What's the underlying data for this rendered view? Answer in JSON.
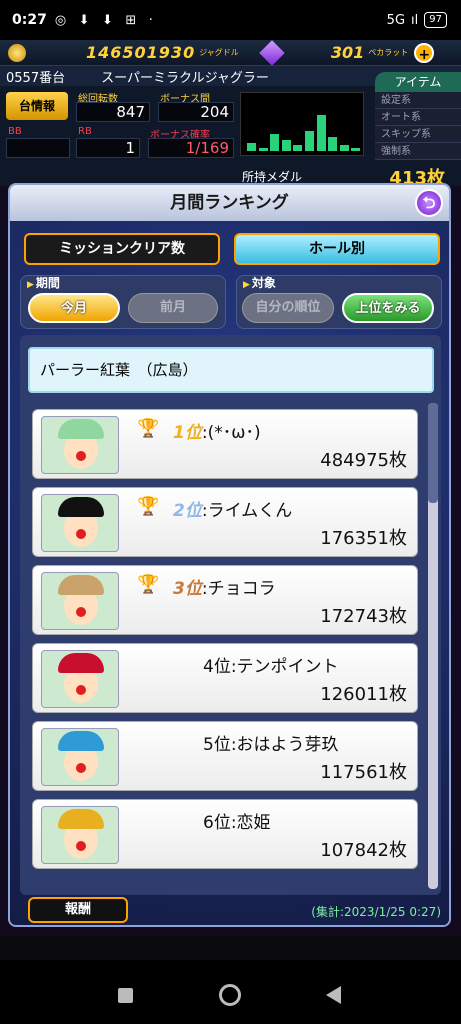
{
  "status_bar": {
    "time": "0:27",
    "icons": [
      "◎",
      "⬇",
      "⬇",
      "⊞",
      "·"
    ],
    "network": "5G",
    "signal": "ıl",
    "battery": "97"
  },
  "top_bar": {
    "coins": "146501930",
    "coin_unit": "ジャグドル",
    "gems": "301",
    "gem_unit": "ぺカラット",
    "plus": "+"
  },
  "machine": {
    "number": "0557番台",
    "name": "スーパーミラクルジャグラー",
    "item_tab": "アイテム"
  },
  "info": {
    "info_button": "台情報",
    "total_spins_label": "総回転数",
    "total_spins": "847",
    "bonus_interval_label": "ボーナス間",
    "bonus_interval": "204",
    "bb_label": "BB",
    "bb": "",
    "rb_label": "RB",
    "rb": "1",
    "bonus_prob_label": "ボーナス確率",
    "bonus_prob": "1/169",
    "medal_label": "所持メダル",
    "medal_value": "413枚"
  },
  "side_menu": [
    "設定系",
    "オート系",
    "スキップ系",
    "強制系"
  ],
  "graph": {
    "bars": [
      0.15,
      0.05,
      0.3,
      0.2,
      0.1,
      0.35,
      0.65,
      0.25,
      0.1,
      0.05
    ]
  },
  "modal": {
    "title": "月間ランキング",
    "back": "⮌",
    "tabs": [
      "ミッションクリア数",
      "ホール別"
    ],
    "period_label": "期間",
    "period_options": [
      "今月",
      "前月"
    ],
    "target_label": "対象",
    "target_options": [
      "自分の順位",
      "上位をみる"
    ],
    "hall_name": "パーラー紅葉　（広島）",
    "rankings": [
      {
        "rank": "1位",
        "name": ":(*･ω･)",
        "medals": "484975枚",
        "trophy": "gold",
        "hat": "#8fd6a0"
      },
      {
        "rank": "2位",
        "name": ":ライムくん",
        "medals": "176351枚",
        "trophy": "silver",
        "hat": "#111111"
      },
      {
        "rank": "3位",
        "name": ":チョコラ",
        "medals": "172743枚",
        "trophy": "bronze",
        "hat": "#c9a36a"
      },
      {
        "rank": "4位",
        "name": ":テンポイント",
        "medals": "126011枚",
        "trophy": "",
        "hat": "#c8102e"
      },
      {
        "rank": "5位",
        "name": ":おはよう芽玖",
        "medals": "117561枚",
        "trophy": "",
        "hat": "#2e9bd6"
      },
      {
        "rank": "6位",
        "name": ":恋姫",
        "medals": "107842枚",
        "trophy": "",
        "hat": "#e8b020"
      }
    ],
    "reward_button": "報酬",
    "timestamp": "(集計:2023/1/25 0:27)"
  }
}
